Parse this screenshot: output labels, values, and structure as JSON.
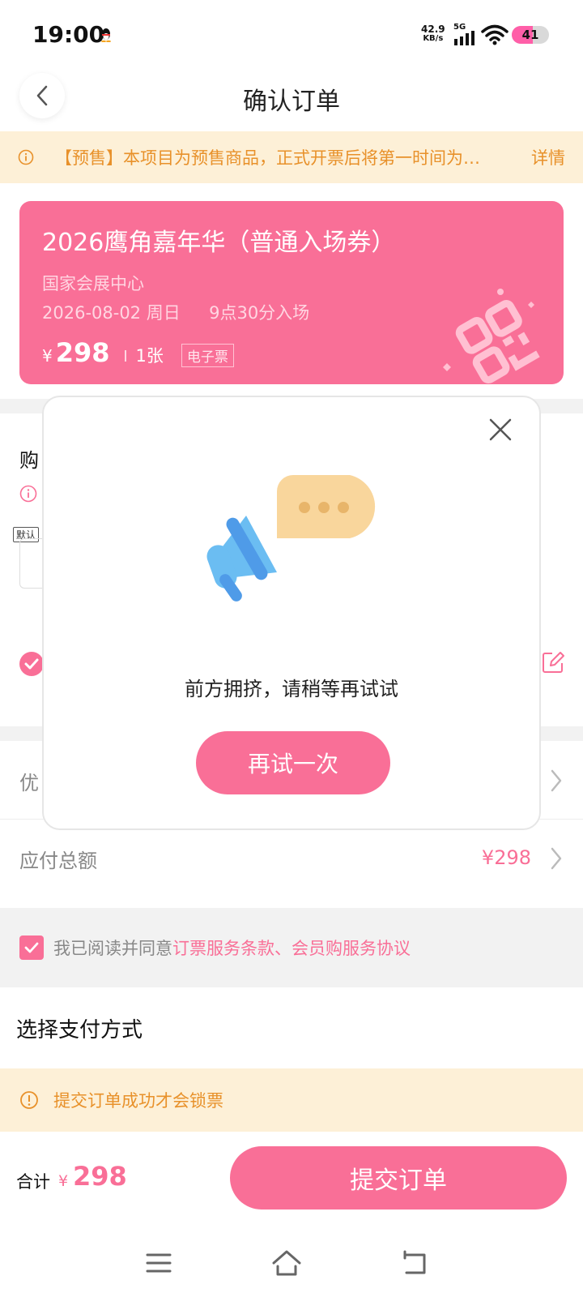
{
  "status_bar": {
    "time": "19:00",
    "net_speed_value": "42.9",
    "net_speed_unit": "KB/s",
    "network": "5G",
    "battery": "41"
  },
  "header": {
    "title": "确认订单"
  },
  "presale_banner": {
    "text": "【预售】本项目为预售商品，正式开票后将第一时间为…",
    "detail_label": "详情",
    "color": "#e8912a"
  },
  "ticket": {
    "name": "2026鹰角嘉年华（普通入场券）",
    "venue": "国家会展中心",
    "date": "2026-08-02 周日",
    "entry_time": "9点30分入场",
    "currency": "¥",
    "price": "298",
    "quantity": "1张",
    "ticket_type": "电子票",
    "color": "#f96f97"
  },
  "buyer": {
    "title_partial": "购",
    "default_tag": "默认"
  },
  "rows": {
    "discount_label_partial": "优",
    "total_label": "应付总额",
    "total_value": "¥298"
  },
  "agreement": {
    "prefix": "我已阅读并同意",
    "link": "订票服务条款、会员购服务协议"
  },
  "payment": {
    "title": "选择支付方式"
  },
  "lock_banner": {
    "text": "提交订单成功才会锁票"
  },
  "bottom_bar": {
    "total_label": "合计",
    "currency": "¥",
    "total_amount": "298",
    "submit_label": "提交订单"
  },
  "modal": {
    "message": "前方拥挤，请稍等再试试",
    "retry_label": "再试一次"
  },
  "icons": {
    "back": "chevron-left-icon",
    "close": "close-icon",
    "info": "info-icon",
    "edit": "edit-icon",
    "chevron": "chevron-right-icon",
    "nav_menu": "menu-icon",
    "nav_home": "home-icon",
    "nav_back": "back-icon"
  }
}
